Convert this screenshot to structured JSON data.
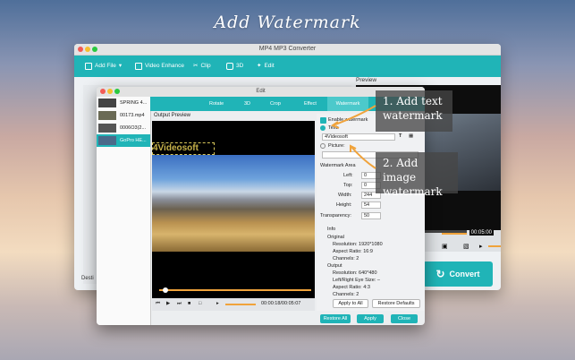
{
  "banner": {
    "title": "Add Watermark"
  },
  "main_window": {
    "title": "MP4 MP3 Converter",
    "toolbar": {
      "add_file": "Add File",
      "video_enhance": "Video Enhance",
      "clip": "Clip",
      "three_d": "3D",
      "edit": "Edit"
    },
    "preview_label": "Preview",
    "preview_time": "00:05:00",
    "convert": "Convert",
    "destination": "Desti"
  },
  "edit_window": {
    "title": "Edit",
    "files": [
      "SPRING 4...",
      "00173.mp4",
      "0006O3(2...",
      "GoPro HE..."
    ],
    "tabs": [
      "Rotate",
      "3D",
      "Crop",
      "Effect",
      "Watermark"
    ],
    "output_preview": "Output Preview",
    "watermark_text_overlay": "4Videosoft",
    "time_display": "00:00:18/00:05:07",
    "enable_watermark": "Enable watermark",
    "text_label": "Text:",
    "text_value": "4Videosoft",
    "picture_label": "Picture:",
    "area_label": "Watermark Area",
    "left_label": "Left:",
    "left_value": "0",
    "top_label": "Top:",
    "top_value": "0",
    "width_label": "Width:",
    "width_value": "244",
    "height_label": "Height:",
    "height_value": "54",
    "transparency_label": "Transparency:",
    "transparency_value": "50",
    "info": {
      "title": "Info",
      "original": "Original",
      "orig_resolution": "Resolution: 1920*1080",
      "orig_aspect": "Aspect Ratio: 16:9",
      "orig_channels": "Channels: 2",
      "output": "Output",
      "out_resolution": "Resolution: 640*480",
      "out_eye": "Left/Right Eye Size: –",
      "out_aspect": "Aspect Ratio: 4:3",
      "out_channels": "Channels: 2"
    },
    "apply_to_all": "Apply to All",
    "restore_defaults": "Restore Defaults",
    "restore_all": "Restore All",
    "apply": "Apply",
    "close": "Close"
  },
  "annotations": {
    "note1": "1. Add text watermark",
    "note2": "2. Add image watermark"
  },
  "colors": {
    "accent": "#20b4b7",
    "orange": "#f0a33b"
  }
}
